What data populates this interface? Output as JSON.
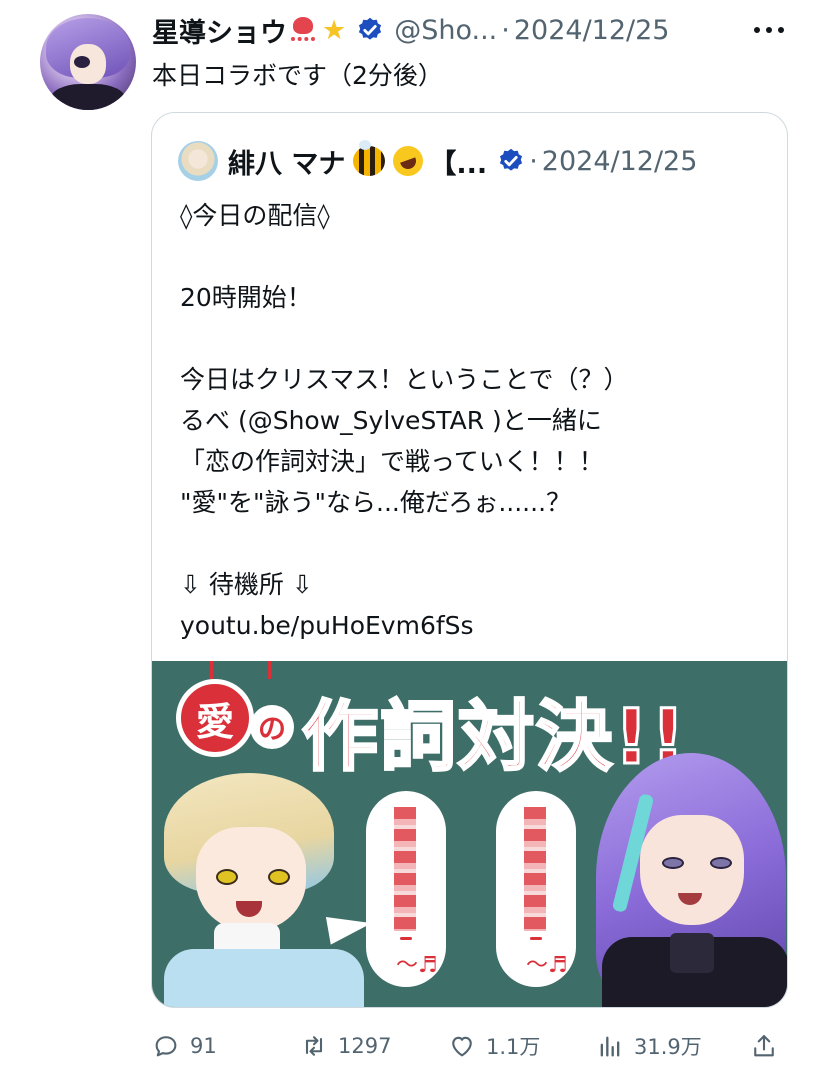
{
  "post": {
    "author_name": "星導ショウ",
    "author_emoji": [
      "octopus-emoji",
      "glowing-star-emoji"
    ],
    "handle": "@Sho...",
    "separator": "·",
    "date": "2024/12/25",
    "text": "本日コラボです（2分後）"
  },
  "quote": {
    "author_name": "緋八 マナ",
    "author_emoji": [
      "bee-emoji",
      "rolling-laughing-emoji"
    ],
    "name_suffix": "【...",
    "separator": "·",
    "date": "2024/12/25",
    "body": "◊今日の配信◊\n\n20時開始！\n\n今日はクリスマス！ということで（？）\nるべ (@Show_SylveSTAR )と一緒に\n「恋の作詞対決」で戦っていく！！！\n\"愛\"を\"詠う\"なら...俺だろぉ......？\n\n⇩ 待機所 ⇩\nyoutu.be/puHoEvm6fSs",
    "image": {
      "badge_text": "愛",
      "connector_text": "の",
      "title_text": "作詞対決!!",
      "note_symbol": "〜♬"
    }
  },
  "actions": {
    "replies": "91",
    "reposts": "1297",
    "likes": "1.1万",
    "views": "31.9万"
  },
  "colors": {
    "text": "#0f1419",
    "secondary": "#536471",
    "border": "#cfd9de",
    "verified": "#1d4ebf",
    "banner_bg": "#3d6e68",
    "banner_red": "#d9303a"
  }
}
